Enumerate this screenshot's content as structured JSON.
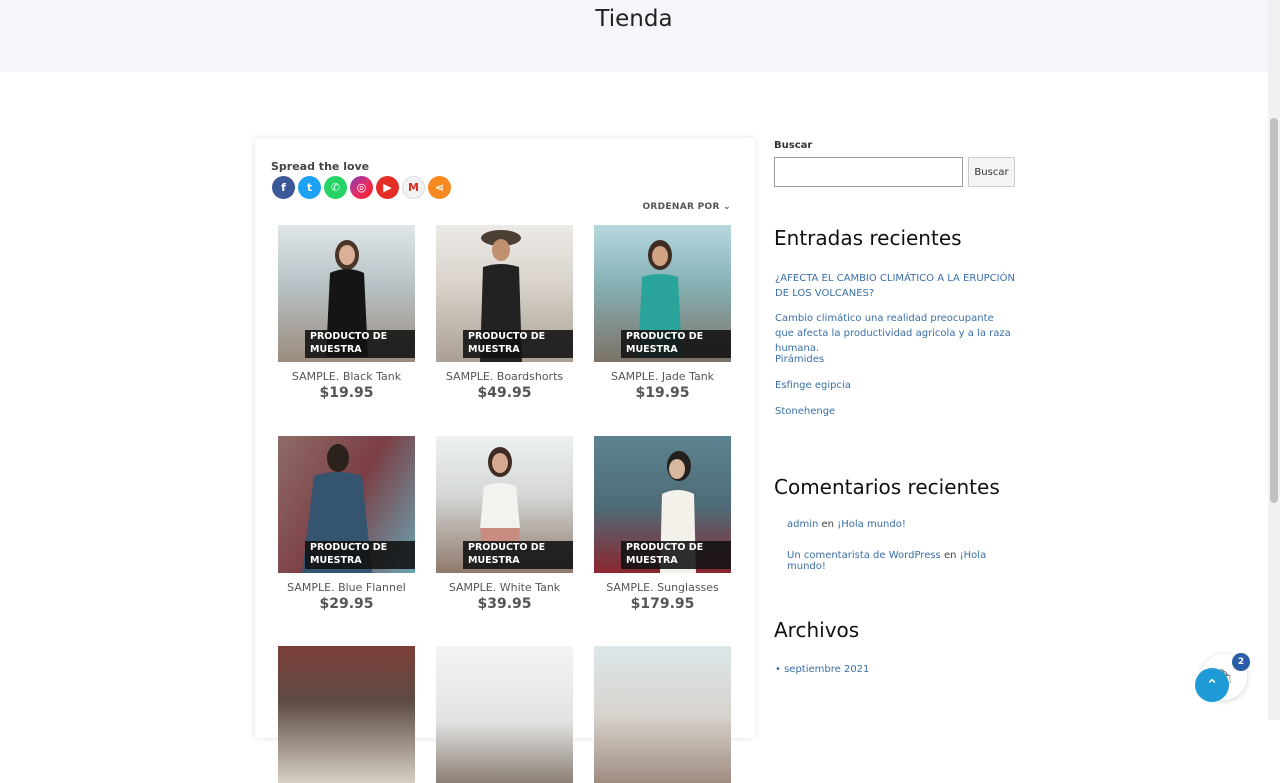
{
  "page": {
    "title": "Tienda"
  },
  "share": {
    "title": "Spread the love",
    "icons": [
      "facebook-icon",
      "twitter-icon",
      "whatsapp-icon",
      "instagram-icon",
      "youtube-icon",
      "gmail-icon",
      "share-more-icon"
    ]
  },
  "shop": {
    "order_label": "ORDENAR POR",
    "badge": "PRODUCTO DE MUESTRA",
    "products": [
      {
        "name": "SAMPLE. Black Tank",
        "price": "$19.95"
      },
      {
        "name": "SAMPLE. Boardshorts",
        "price": "$49.95"
      },
      {
        "name": "SAMPLE. Jade Tank",
        "price": "$19.95"
      },
      {
        "name": "SAMPLE. Blue Flannel",
        "price": "$29.95"
      },
      {
        "name": "SAMPLE. White Tank",
        "price": "$39.95"
      },
      {
        "name": "SAMPLE. Sunglasses",
        "price": "$179.95"
      }
    ]
  },
  "sidebar": {
    "search_label": "Buscar",
    "search_button": "Buscar",
    "recent_posts_title": "Entradas recientes",
    "recent_posts": [
      "¿AFECTA EL CAMBIO CLIMÁTICO A LA ERUPCIÓN DE LOS VOLCANES?",
      "Cambio climático una realidad preocupante que afecta la productividad agricola y a la raza humana.",
      "Pirámides",
      "Esfinge egipcia",
      "Stonehenge"
    ],
    "recent_comments_title": "Comentarios recientes",
    "comments": [
      {
        "author": "admin",
        "sep": "en",
        "post": "¡Hola mundo!"
      },
      {
        "author": "Un comentarista de WordPress",
        "sep": "en",
        "post": "¡Hola mundo!"
      }
    ],
    "archives_title": "Archivos",
    "archives": [
      "septiembre 2021"
    ]
  },
  "cart": {
    "count": "2"
  }
}
